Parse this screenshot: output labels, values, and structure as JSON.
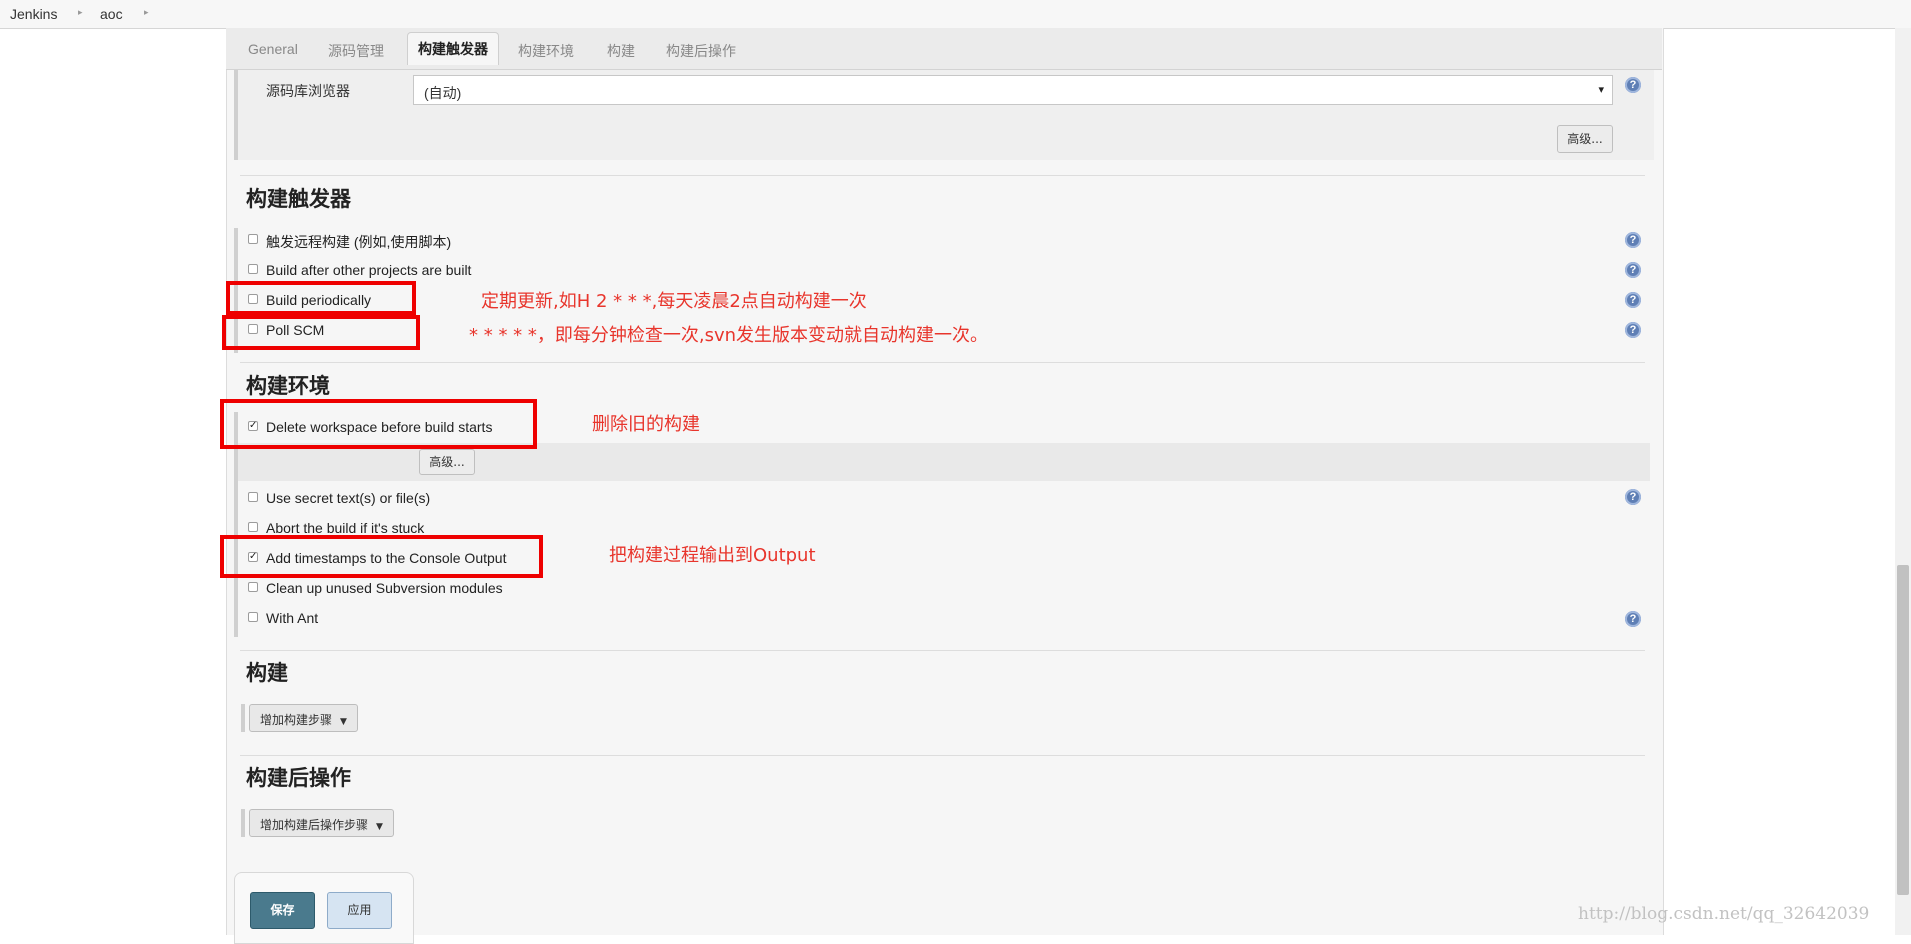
{
  "breadcrumb": [
    "Jenkins",
    "aoc"
  ],
  "tabs": [
    "General",
    "源码管理",
    "构建触发器",
    "构建环境",
    "构建",
    "构建后操作"
  ],
  "active_tab": 2,
  "scm": {
    "browser_label": "源码库浏览器",
    "browser_value": "(自动)",
    "advanced_label": "高级..."
  },
  "triggers": {
    "title": "构建触发器",
    "options": [
      {
        "label": "触发远程构建 (例如,使用脚本)",
        "checked": false
      },
      {
        "label": "Build after other projects are built",
        "checked": false
      },
      {
        "label": "Build periodically",
        "checked": false
      },
      {
        "label": "Poll SCM",
        "checked": false
      }
    ]
  },
  "environment": {
    "title": "构建环境",
    "advanced_label": "高级...",
    "options": [
      {
        "label": "Delete workspace before build starts",
        "checked": true
      },
      {
        "label": "Use secret text(s) or file(s)",
        "checked": false
      },
      {
        "label": "Abort the build if it's stuck",
        "checked": false
      },
      {
        "label": "Add timestamps to the Console Output",
        "checked": true
      },
      {
        "label": "Clean up unused Subversion modules",
        "checked": false
      },
      {
        "label": "With Ant",
        "checked": false
      }
    ]
  },
  "build": {
    "title": "构建",
    "add_step_label": "增加构建步骤"
  },
  "post_build": {
    "title": "构建后操作",
    "add_step_label": "增加构建后操作步骤"
  },
  "footer": {
    "save_label": "保存",
    "apply_label": "应用"
  },
  "annotations": {
    "periodic_note": "定期更新,如H 2 * * *,每天凌晨2点自动构建一次",
    "poll_note": "* * * * *，即每分钟检查一次,svn发生版本变动就自动构建一次。",
    "delete_note": "删除旧的构建",
    "timestamps_note": "把构建过程输出到Output"
  },
  "watermark": "http://blog.csdn.net/qq_32642039",
  "colors": {
    "accent": "#4a7a8d",
    "annotation_red": "#ee0000",
    "help_icon": "#5f7fb5"
  },
  "icons": [
    "chevron-right-icon",
    "dropdown-arrow-icon",
    "help-icon",
    "checkbox-icon",
    "caret-down-icon"
  ]
}
